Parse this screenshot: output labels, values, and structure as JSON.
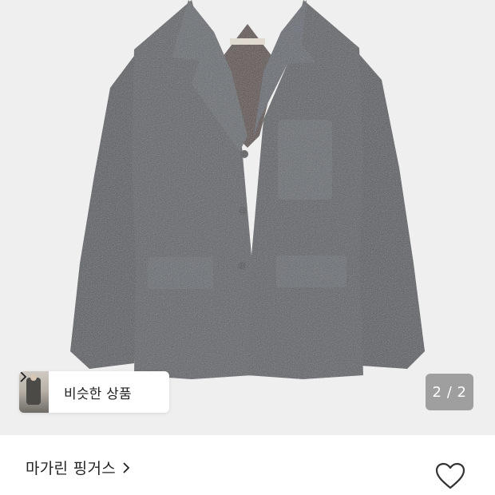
{
  "product_image": {
    "alt_icon": "gray-fuzzy-blazer-image",
    "background_color": "#efefef",
    "jacket_color": "#5d6065"
  },
  "similar_products": {
    "label": "비슷한 상품",
    "thumbnail_icon": "similar-product-thumbnail",
    "chevron_icon": "chevron-right-icon"
  },
  "pagination": {
    "text": "2 / 2",
    "current": 2,
    "total": 2
  },
  "brand": {
    "name": "마가린 핑거스",
    "chevron_icon": "chevron-right-icon"
  },
  "wishlist": {
    "icon": "heart-outline-icon"
  }
}
